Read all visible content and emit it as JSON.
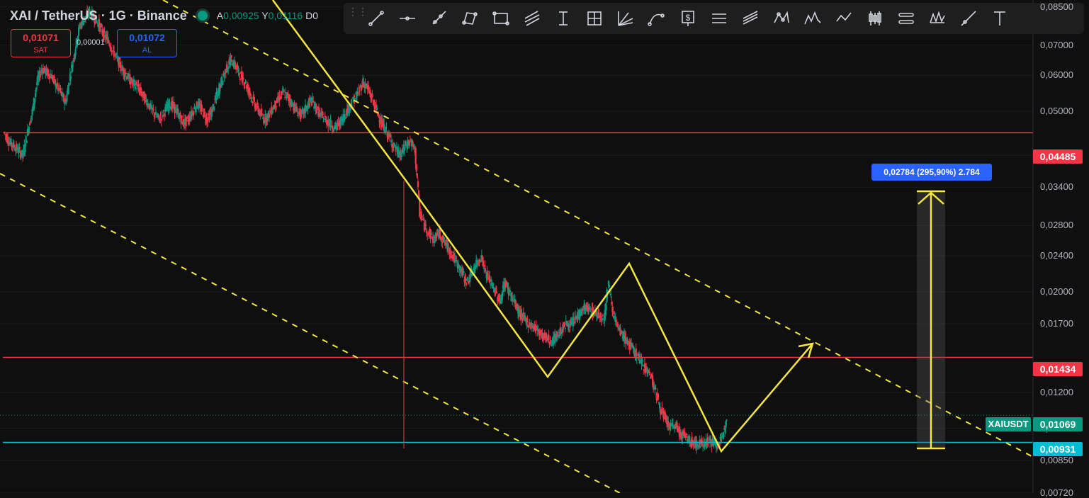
{
  "legend": {
    "symbol": "XAI / TetherUS · 1G · Binance",
    "open_label": "A",
    "open_value": "0,00925",
    "high_label": "Y",
    "high_value": "0,01116",
    "extra_label": "D0"
  },
  "order_panel": {
    "sell_price": "0,01071",
    "sell_label": "SAT",
    "spread": "0,00001",
    "buy_price": "0,01072",
    "buy_label": "AL"
  },
  "toolbar": {
    "tools": [
      "trend-line-icon",
      "horizontal-ray-icon",
      "ray-icon",
      "rotated-rectangle-icon",
      "rectangle-icon",
      "parallel-channel-icon",
      "long-position-icon",
      "fib-retracement-icon",
      "gann-fan-icon",
      "curve-icon",
      "price-range-icon",
      "date-range-icon",
      "regression-trend-icon",
      "xabcd-pattern-icon",
      "elliott-wave-icon",
      "path-icon",
      "candle-bars-icon",
      "price-note-icon",
      "head-shoulders-icon",
      "info-line-icon",
      "text-icon"
    ]
  },
  "price_axis": {
    "ticks": [
      {
        "label": "0,08500",
        "price": 0.085
      },
      {
        "label": "0,07000",
        "price": 0.07
      },
      {
        "label": "0,06000",
        "price": 0.06
      },
      {
        "label": "0,05000",
        "price": 0.05
      },
      {
        "label": "0,04000",
        "price": 0.04
      },
      {
        "label": "0,03400",
        "price": 0.034
      },
      {
        "label": "0,02800",
        "price": 0.028
      },
      {
        "label": "0,02400",
        "price": 0.024
      },
      {
        "label": "0,02000",
        "price": 0.02
      },
      {
        "label": "0,01700",
        "price": 0.017
      },
      {
        "label": "0,01200",
        "price": 0.012
      },
      {
        "label": "0,01000",
        "price": 0.01
      },
      {
        "label": "0,00850",
        "price": 0.0085
      },
      {
        "label": "0,00720",
        "price": 0.0072
      }
    ]
  },
  "levels": {
    "resistance_1": {
      "label": "0,04485",
      "price": 0.04485,
      "color": "#f23645"
    },
    "resistance_2": {
      "label": "0,01434",
      "price": 0.01434,
      "color": "#f23645"
    },
    "support": {
      "label": "0,00931",
      "price": 0.00931,
      "color": "#00bcd4"
    },
    "last_price": {
      "label": "0,01069",
      "price": 0.01069,
      "color": "#089981",
      "symbol": "XAIUSDT"
    }
  },
  "measure": {
    "text": "0,02784 (295,90%) 2.784"
  },
  "colors": {
    "up": "#089981",
    "down": "#f23645",
    "drawing": "#f5e642",
    "background": "#0f0f0f"
  },
  "chart_data": {
    "type": "candlestick",
    "scale": "log",
    "ylim": [
      0.0072,
      0.088
    ],
    "close_path": [
      0.045,
      0.043,
      0.042,
      0.041,
      0.04,
      0.045,
      0.05,
      0.058,
      0.062,
      0.061,
      0.06,
      0.057,
      0.055,
      0.052,
      0.06,
      0.068,
      0.077,
      0.08,
      0.083,
      0.081,
      0.078,
      0.074,
      0.072,
      0.068,
      0.065,
      0.062,
      0.06,
      0.058,
      0.057,
      0.055,
      0.053,
      0.051,
      0.049,
      0.048,
      0.05,
      0.052,
      0.051,
      0.049,
      0.047,
      0.048,
      0.05,
      0.052,
      0.05,
      0.048,
      0.05,
      0.054,
      0.058,
      0.062,
      0.065,
      0.063,
      0.06,
      0.058,
      0.055,
      0.052,
      0.05,
      0.048,
      0.049,
      0.051,
      0.053,
      0.055,
      0.054,
      0.052,
      0.05,
      0.049,
      0.051,
      0.053,
      0.051,
      0.049,
      0.048,
      0.047,
      0.046,
      0.047,
      0.049,
      0.051,
      0.053,
      0.055,
      0.058,
      0.056,
      0.053,
      0.05,
      0.047,
      0.045,
      0.043,
      0.041,
      0.04,
      0.042,
      0.043,
      0.041,
      0.03,
      0.028,
      0.027,
      0.026,
      0.027,
      0.026,
      0.025,
      0.024,
      0.023,
      0.022,
      0.021,
      0.022,
      0.023,
      0.024,
      0.022,
      0.021,
      0.02,
      0.019,
      0.021,
      0.02,
      0.019,
      0.018,
      0.0175,
      0.017,
      0.0168,
      0.0165,
      0.016,
      0.0158,
      0.0155,
      0.016,
      0.0165,
      0.017,
      0.0168,
      0.0175,
      0.018,
      0.0185,
      0.0182,
      0.018,
      0.0178,
      0.0175,
      0.021,
      0.018,
      0.0165,
      0.016,
      0.0155,
      0.015,
      0.0145,
      0.014,
      0.0135,
      0.013,
      0.012,
      0.011,
      0.0105,
      0.01,
      0.0102,
      0.0098,
      0.0096,
      0.0094,
      0.0093,
      0.0092,
      0.0093,
      0.0094,
      0.0093,
      0.0092,
      0.0094,
      0.0107
    ]
  }
}
